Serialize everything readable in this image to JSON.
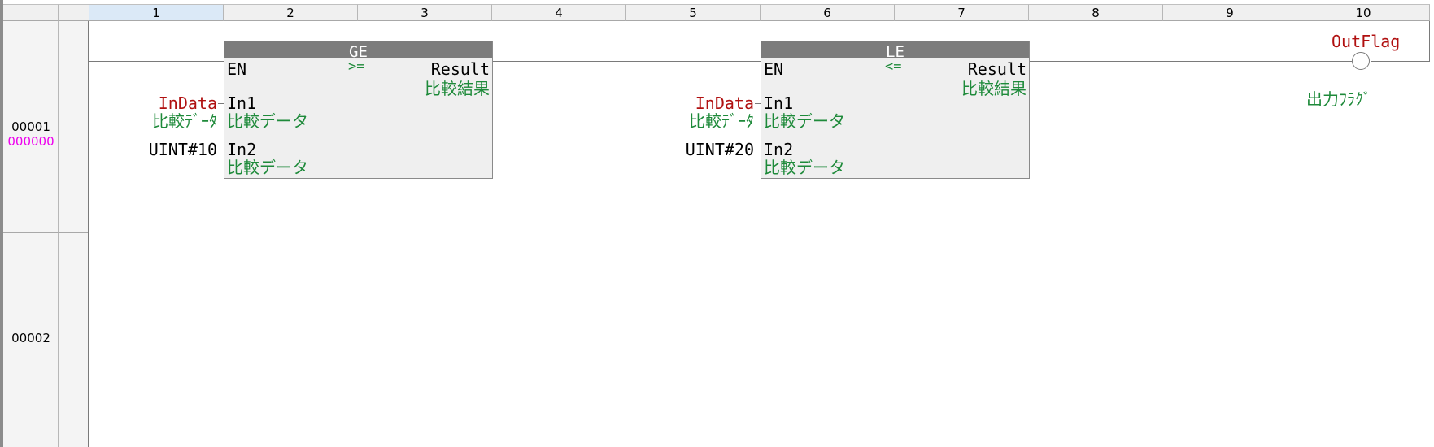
{
  "columns": [
    "1",
    "2",
    "3",
    "4",
    "5",
    "6",
    "7",
    "8",
    "9",
    "10"
  ],
  "rows": [
    {
      "number": "00001",
      "address": "000000"
    },
    {
      "number": "00002",
      "address": ""
    }
  ],
  "blocks": [
    {
      "name": "GE",
      "operator": ">=",
      "en": "EN",
      "out_name": "Result",
      "out_comment": "比較結果",
      "in1_name": "In1",
      "in1_comment": "比較データ",
      "in2_name": "In2",
      "in2_comment": "比較データ",
      "in1_var": "InData",
      "in1_var_comment": "比較ﾃﾞｰﾀ",
      "in2_const": "UINT#10"
    },
    {
      "name": "LE",
      "operator": "<=",
      "en": "EN",
      "out_name": "Result",
      "out_comment": "比較結果",
      "in1_name": "In1",
      "in1_comment": "比較データ",
      "in2_name": "In2",
      "in2_comment": "比較データ",
      "in1_var": "InData",
      "in1_var_comment": "比較ﾃﾞｰﾀ",
      "in2_const": "UINT#20"
    }
  ],
  "coil": {
    "var": "OutFlag",
    "comment": "出力ﾌﾗｸﾞ"
  },
  "colors": {
    "variable": "#b01010",
    "comment": "#1e8a3a",
    "address": "#ee00ee",
    "block_header": "#7c7c7c"
  }
}
